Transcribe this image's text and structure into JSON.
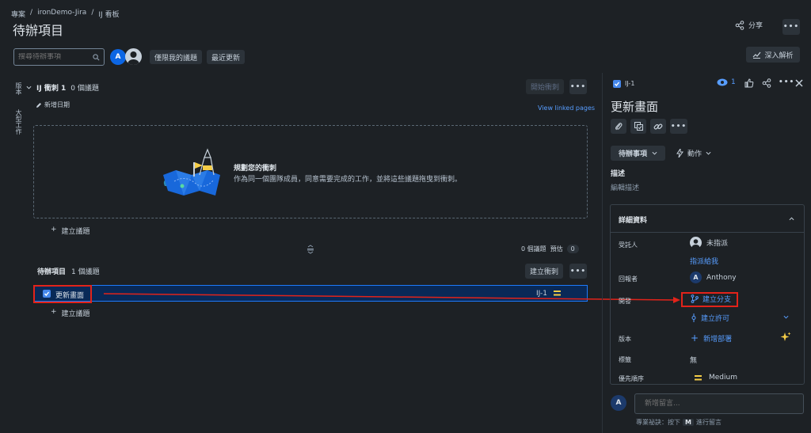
{
  "breadcrumb": {
    "projects": "專案",
    "project": "ironDemo-Jira",
    "board": "IJ 看板",
    "sep": "/"
  },
  "page_title": "待辦項目",
  "header": {
    "share_label": "分享",
    "insights_label": "深入解析"
  },
  "toolbar": {
    "search_placeholder": "搜尋待辦事項",
    "avatar_letter": "A",
    "only_my_issues": "僅限我的議題",
    "recently_updated": "最近更新"
  },
  "side_tabs": {
    "version": "版本",
    "epic": "大型工作"
  },
  "sprint": {
    "title": "IJ 衝刺 1",
    "count": "0 個議題",
    "add_dates": "新增日期",
    "start_button": "開始衝刺",
    "view_linked": "View linked pages",
    "empty_title": "規劃您的衝刺",
    "empty_desc": "作為同一個團隊成員，同意需要完成的工作，並將這些議題拖曳到衝刺。",
    "create_issue": "建立議題"
  },
  "backlog": {
    "title": "待辦項目",
    "count": "1 個議題",
    "stats_count": "0 個議題",
    "stats_estimate_label": "預估",
    "stats_estimate_value": "0",
    "create_sprint": "建立衝刺",
    "create_issue": "建立議題",
    "issues": [
      {
        "summary": "更新畫面",
        "key": "IJ-1"
      }
    ]
  },
  "detail": {
    "key": "IJ-1",
    "watch_count": "1",
    "title": "更新畫面",
    "status": "待辦事項",
    "actions": "動作",
    "description_label": "描述",
    "description_placeholder": "編輯描述",
    "details_header": "詳細資料",
    "assignee_label": "受託人",
    "assignee_value": "未指派",
    "assign_to_me": "指派給我",
    "reporter_label": "回報者",
    "reporter_avatar": "A",
    "reporter_name": "Anthony",
    "development_label": "開發",
    "create_branch": "建立分支",
    "create_commit": "建立許可",
    "version_label": "版本",
    "add_deployment": "新增部署",
    "labels_label": "標籤",
    "labels_value": "無",
    "priority_label": "優先順序",
    "priority_value": "Medium",
    "comment_avatar": "A",
    "comment_placeholder": "新增留言...",
    "tip_prefix": "專業祕訣：按下",
    "tip_key": "M",
    "tip_suffix": "進行留言"
  },
  "colors": {
    "annotation_red": "#e2231a",
    "link_blue": "#579dff",
    "priority_orange": "#f5cd47",
    "background": "#1d2125"
  }
}
